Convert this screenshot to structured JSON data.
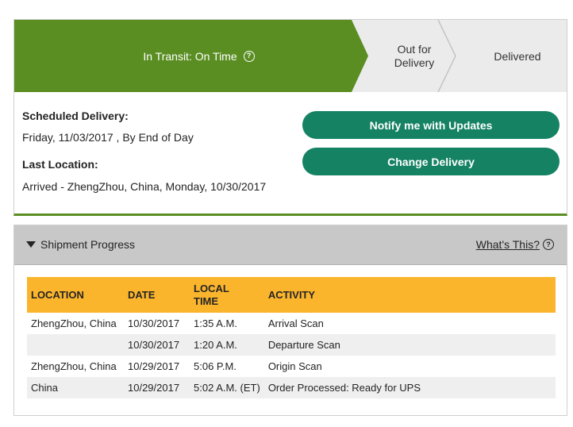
{
  "progress": {
    "current_step": "In Transit: On Time",
    "steps": [
      "Out for Delivery",
      "Delivered"
    ],
    "colors": {
      "current": "#5a8e22",
      "pending": "#ebebeb",
      "button": "#148263",
      "table_header": "#fbb52d"
    }
  },
  "delivery": {
    "scheduled_label": "Scheduled Delivery:",
    "scheduled_value": "Friday, 11/03/2017 , By End of Day",
    "last_location_label": "Last Location:",
    "last_location_value": "Arrived - ZhengZhou, China, Monday, 10/30/2017"
  },
  "actions": {
    "notify": "Notify me with Updates",
    "change": "Change Delivery"
  },
  "shipment_progress": {
    "title": "Shipment Progress",
    "whats_this": "What's This?",
    "columns": [
      "LOCATION",
      "DATE",
      "LOCAL TIME",
      "ACTIVITY"
    ],
    "rows": [
      [
        "ZhengZhou, China",
        "10/30/2017",
        "1:35 A.M.",
        "Arrival Scan"
      ],
      [
        "",
        "10/30/2017",
        "1:20 A.M.",
        "Departure Scan"
      ],
      [
        "ZhengZhou, China",
        "10/29/2017",
        "5:06 P.M.",
        "Origin Scan"
      ],
      [
        "China",
        "10/29/2017",
        "5:02 A.M. (ET)",
        "Order Processed: Ready for UPS"
      ]
    ]
  },
  "icons": {
    "help": "help-circle-icon",
    "caret": "caret-down-icon"
  }
}
